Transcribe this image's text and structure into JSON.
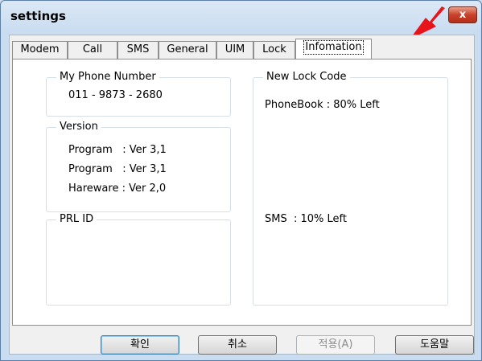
{
  "window": {
    "title": "settings",
    "close_label": "x"
  },
  "tabs": [
    {
      "label": "Modem"
    },
    {
      "label": "Call"
    },
    {
      "label": "SMS"
    },
    {
      "label": "General"
    },
    {
      "label": "UIM"
    },
    {
      "label": "Lock"
    },
    {
      "label": "Infomation",
      "active": true
    }
  ],
  "info": {
    "phone_number": {
      "label": "My Phone Number",
      "value": "011 - 9873 - 2680"
    },
    "version": {
      "label": "Version",
      "lines": [
        "Program   : Ver 3,1",
        "Program   : Ver 3,1",
        "Hareware : Ver 2,0"
      ]
    },
    "prl": {
      "label": "PRL ID"
    },
    "lock": {
      "label": "New Lock Code",
      "phonebook": "PhoneBook : 80% Left",
      "sms": "SMS  : 10% Left"
    }
  },
  "buttons": {
    "ok": "확인",
    "cancel": "취소",
    "apply": "적용(A)",
    "help": "도움말"
  },
  "colors": {
    "annotation_arrow": "#e8141c"
  }
}
